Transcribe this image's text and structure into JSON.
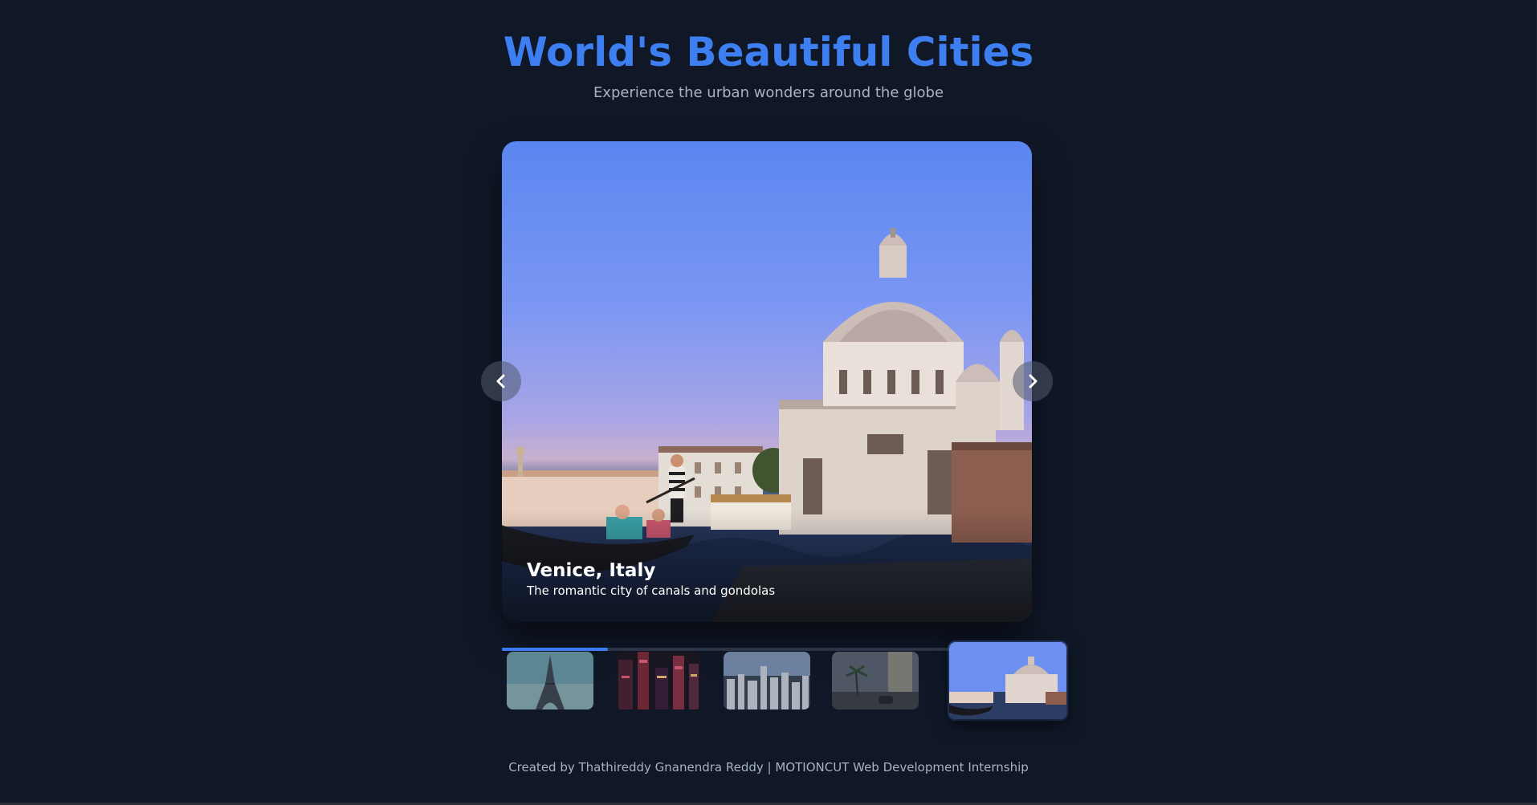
{
  "header": {
    "title": "World's Beautiful Cities",
    "subtitle": "Experience the urban wonders around the globe"
  },
  "slide": {
    "city": "Venice, Italy",
    "description": "The romantic city of canals and gondolas",
    "image_icon": "venice-photo"
  },
  "controls": {
    "prev_icon": "chevron-left-icon",
    "next_icon": "chevron-right-icon"
  },
  "progress": {
    "fraction": 0.2
  },
  "thumbnails": [
    {
      "name": "paris-thumbnail",
      "active": false
    },
    {
      "name": "tokyo-thumbnail",
      "active": false
    },
    {
      "name": "new-york-thumbnail",
      "active": false
    },
    {
      "name": "dubai-thumbnail",
      "active": false
    },
    {
      "name": "venice-thumbnail",
      "active": true
    }
  ],
  "footer": {
    "text": "Created by Thathireddy Gnanendra Reddy | MOTIONCUT Web Development Internship"
  },
  "colors": {
    "background": "#101828",
    "accent": "#3d7ef0",
    "muted_text": "#a8b2c4"
  }
}
